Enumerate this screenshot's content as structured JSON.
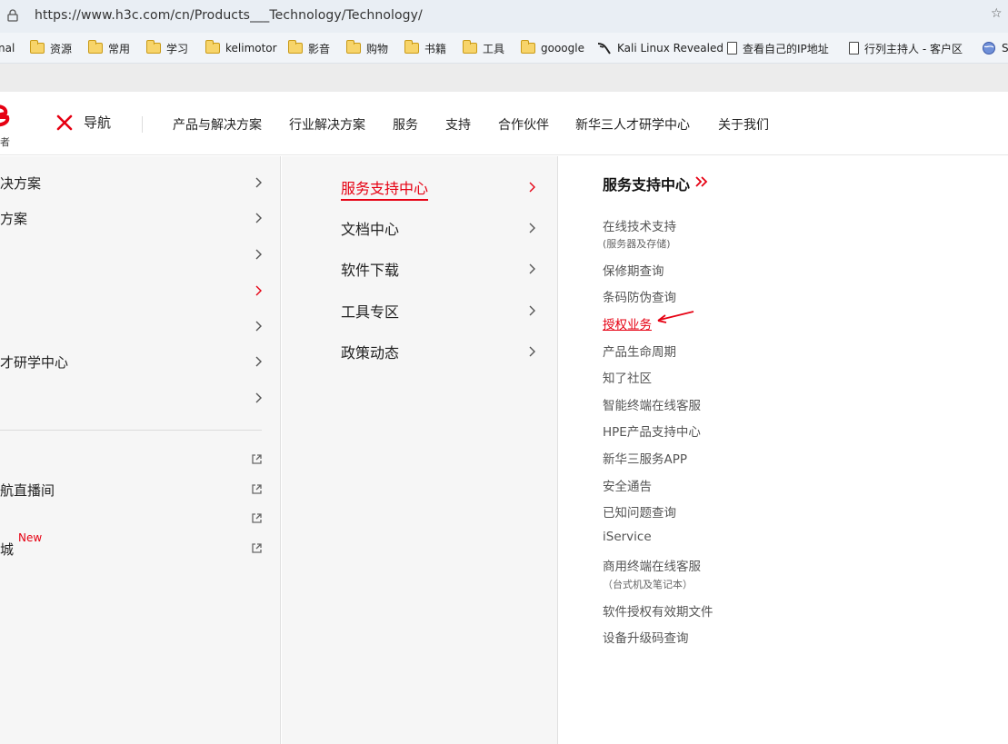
{
  "browser": {
    "url": "https://www.h3c.com/cn/Products___Technology/Technology/",
    "url_end": "☆"
  },
  "bookmarks": [
    {
      "label": "nal",
      "icon": "none"
    },
    {
      "label": "资源",
      "icon": "folder-icon"
    },
    {
      "label": "常用",
      "icon": "folder-icon"
    },
    {
      "label": "学习",
      "icon": "folder-icon"
    },
    {
      "label": "kelimotor",
      "icon": "folder-icon"
    },
    {
      "label": "影音",
      "icon": "folder-icon"
    },
    {
      "label": "购物",
      "icon": "folder-icon"
    },
    {
      "label": "书籍",
      "icon": "folder-icon"
    },
    {
      "label": "工具",
      "icon": "folder-icon"
    },
    {
      "label": "gooogle",
      "icon": "folder-icon"
    },
    {
      "label": "Kali Linux Revealed",
      "icon": "kali-icon"
    },
    {
      "label": "查看自己的IP地址",
      "icon": "page-icon"
    },
    {
      "label": "行列主持人 - 客户区",
      "icon": "page-icon"
    },
    {
      "label": "S",
      "icon": "globe-icon"
    }
  ],
  "header": {
    "logo_sub": "者",
    "nav_toggle_label": "导航",
    "nav": [
      "产品与解决方案",
      "行业解决方案",
      "服务",
      "支持",
      "合作伙伴",
      "新华三人才研学中心",
      "关于我们"
    ]
  },
  "col1": {
    "items": [
      "决方案",
      "方案",
      "",
      "",
      "",
      "才研学中心",
      ""
    ],
    "ext_items": [
      "",
      "航直播间",
      "",
      "城"
    ],
    "new_badge": "New"
  },
  "col2": {
    "items": [
      "服务支持中心",
      "文档中心",
      "软件下载",
      "工具专区",
      "政策动态"
    ]
  },
  "col3": {
    "title": "服务支持中心",
    "links": [
      {
        "label": "在线技术支持",
        "sub": "(服务器及存储)"
      },
      {
        "label": "保修期查询"
      },
      {
        "label": "条码防伪查询"
      },
      {
        "label": "授权业务"
      },
      {
        "label": "产品生命周期"
      },
      {
        "label": "知了社区"
      },
      {
        "label": "智能终端在线客服"
      },
      {
        "label": "HPE产品支持中心"
      },
      {
        "label": "新华三服务APP"
      },
      {
        "label": "安全通告"
      },
      {
        "label": "已知问题查询"
      },
      {
        "label": "iService"
      },
      {
        "label": "商用终端在线客服",
        "sub": "（台式机及笔记本）"
      },
      {
        "label": "软件授权有效期文件"
      },
      {
        "label": "设备升级码查询"
      }
    ]
  },
  "colors": {
    "brand_red": "#e60012",
    "panel_gray": "#f6f6f6",
    "link_gray": "#555555"
  }
}
